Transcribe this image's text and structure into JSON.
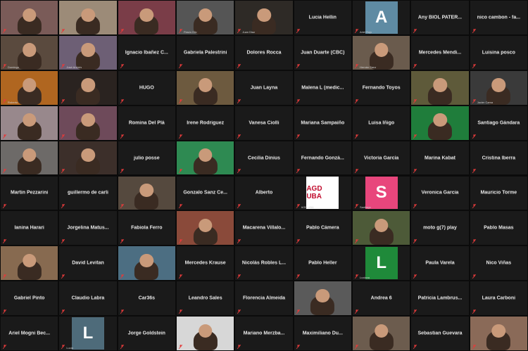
{
  "participants_grid": [
    [
      {
        "type": "video",
        "caption": "",
        "bg": "#7a5b58"
      },
      {
        "type": "video",
        "caption": "",
        "bg": "#9c8b78"
      },
      {
        "type": "video",
        "caption": "",
        "bg": "#7a3d48"
      },
      {
        "type": "video",
        "caption": "Flavia Oliv",
        "bg": "#555"
      },
      {
        "type": "video",
        "caption": "Juan Diaz",
        "bg": "#2e2a26"
      },
      {
        "type": "name",
        "name": "Lucia Hellin"
      },
      {
        "type": "avatar",
        "letter": "A",
        "color": "#5f8ba3",
        "caption": "Ariel Rojo"
      },
      {
        "type": "name",
        "name": "Any BIOL PATER..."
      },
      {
        "type": "name",
        "name": "nico cambon - fa..."
      }
    ],
    [
      {
        "type": "video",
        "caption": "Domingo",
        "bg": "#5a4a3e"
      },
      {
        "type": "video",
        "caption": "José Andrés",
        "bg": "#6d5f75"
      },
      {
        "type": "name",
        "name": "Ignacio Ibañez C..."
      },
      {
        "type": "name",
        "name": "Gabriela Palestrini"
      },
      {
        "type": "name",
        "name": "Dolores Rocca"
      },
      {
        "type": "name",
        "name": "Juan Duarte (CBC)"
      },
      {
        "type": "video",
        "caption": "Hernán Sanz",
        "bg": "#6a5b4d"
      },
      {
        "type": "name",
        "name": "Mercedes Mendi..."
      },
      {
        "type": "name",
        "name": "Luisina posco"
      }
    ],
    [
      {
        "type": "video",
        "caption": "Roberto",
        "bg": "#b06620"
      },
      {
        "type": "video",
        "caption": "",
        "bg": "#2a2320"
      },
      {
        "type": "name",
        "name": "HUGO"
      },
      {
        "type": "video",
        "caption": "",
        "bg": "#6d5a3f"
      },
      {
        "type": "name",
        "name": "Juan Layna"
      },
      {
        "type": "name",
        "name": "Malena L (medic..."
      },
      {
        "type": "name",
        "name": "Fernando Toyos"
      },
      {
        "type": "video",
        "caption": "",
        "bg": "#5e5a3a"
      },
      {
        "type": "video",
        "caption": "Javier Cama",
        "bg": "#3a3a3a"
      }
    ],
    [
      {
        "type": "video",
        "caption": "",
        "bg": "#98888c"
      },
      {
        "type": "video",
        "caption": "",
        "bg": "#6e4a5a"
      },
      {
        "type": "name",
        "name": "Romina Del Plá"
      },
      {
        "type": "name",
        "name": "Irene Rodriguez"
      },
      {
        "type": "name",
        "name": "Vanesa Ciolli"
      },
      {
        "type": "name",
        "name": "Mariana Sampaiño"
      },
      {
        "type": "name",
        "name": "Luisa Iñigo"
      },
      {
        "type": "video",
        "caption": "",
        "bg": "#1f7d3b"
      },
      {
        "type": "name",
        "name": "Santiago Gándara"
      }
    ],
    [
      {
        "type": "video",
        "caption": "",
        "bg": "#6d6a68"
      },
      {
        "type": "video",
        "caption": "",
        "bg": "#3c2f2a"
      },
      {
        "type": "name",
        "name": "julio posse"
      },
      {
        "type": "video",
        "caption": "",
        "bg": "#2e8a52"
      },
      {
        "type": "name",
        "name": "Cecilia Dinius"
      },
      {
        "type": "name",
        "name": "Fernando Gonzá..."
      },
      {
        "type": "name",
        "name": "Victoria García"
      },
      {
        "type": "name",
        "name": "Marina Kabat"
      },
      {
        "type": "name",
        "name": "Cristina Iberra"
      }
    ],
    [
      {
        "type": "name",
        "name": "Martin Pezzarini"
      },
      {
        "type": "name",
        "name": "guillermo de carli"
      },
      {
        "type": "video",
        "caption": "",
        "bg": "#55493e"
      },
      {
        "type": "name",
        "name": "Gonzalo Sanz Ce..."
      },
      {
        "type": "name",
        "name": "Alberto"
      },
      {
        "type": "agd",
        "caption": "AGD UBA",
        "logo": "AGD UBA"
      },
      {
        "type": "avatar",
        "letter": "S",
        "color": "#e8467c",
        "caption": "Santiago"
      },
      {
        "type": "name",
        "name": "Veronica Garcia"
      },
      {
        "type": "name",
        "name": "Mauricio Torme"
      }
    ],
    [
      {
        "type": "name",
        "name": "Ianina Harari"
      },
      {
        "type": "name",
        "name": "Jorgelina Matus..."
      },
      {
        "type": "name",
        "name": "Fabiola Ferro"
      },
      {
        "type": "video",
        "caption": "",
        "bg": "#8a4a3a"
      },
      {
        "type": "name",
        "name": "Macarena Villalo..."
      },
      {
        "type": "name",
        "name": "Pablo Cámera"
      },
      {
        "type": "video",
        "caption": "",
        "bg": "#4d5a38"
      },
      {
        "type": "name",
        "name": "moto g(7) play"
      },
      {
        "type": "name",
        "name": "Pablo Masas"
      }
    ],
    [
      {
        "type": "video",
        "caption": "",
        "bg": "#876a50"
      },
      {
        "type": "name",
        "name": "David Levitan"
      },
      {
        "type": "video",
        "caption": "",
        "bg": "#4c6e82"
      },
      {
        "type": "name",
        "name": "Mercedes Krause"
      },
      {
        "type": "name",
        "name": "Nicolás Robles L..."
      },
      {
        "type": "name",
        "name": "Pablo Heller"
      },
      {
        "type": "avatar",
        "letter": "L",
        "color": "#1f8a3a",
        "caption": "Luciana"
      },
      {
        "type": "name",
        "name": "Paula Varela"
      },
      {
        "type": "name",
        "name": "Nico Viñas"
      }
    ],
    [
      {
        "type": "name",
        "name": "Gabriel Pinto"
      },
      {
        "type": "name",
        "name": "Claudio Labra"
      },
      {
        "type": "name",
        "name": "Car36s"
      },
      {
        "type": "name",
        "name": "Leandro Sales"
      },
      {
        "type": "name",
        "name": "Florencia Almeida"
      },
      {
        "type": "video",
        "caption": "",
        "bg": "#5a5a5a"
      },
      {
        "type": "name",
        "name": "Andrea 6"
      },
      {
        "type": "name",
        "name": "Patricia Lambrus..."
      },
      {
        "type": "name",
        "name": "Laura Carboni"
      }
    ],
    [
      {
        "type": "name",
        "name": "Ariel Mogni Bec..."
      },
      {
        "type": "avatar",
        "letter": "L",
        "color": "#4e6b7a",
        "caption": "Lucia"
      },
      {
        "type": "name",
        "name": "Jorge Goldstein"
      },
      {
        "type": "video",
        "caption": "",
        "bg": "#d7d7d7"
      },
      {
        "type": "name",
        "name": "Mariano Merzba..."
      },
      {
        "type": "name",
        "name": "Maximiliano Du..."
      },
      {
        "type": "video",
        "caption": "",
        "bg": "#6c5c4e"
      },
      {
        "type": "name",
        "name": "Sebastian Guevara"
      },
      {
        "type": "video",
        "caption": "",
        "bg": "#8a6a58"
      }
    ]
  ]
}
